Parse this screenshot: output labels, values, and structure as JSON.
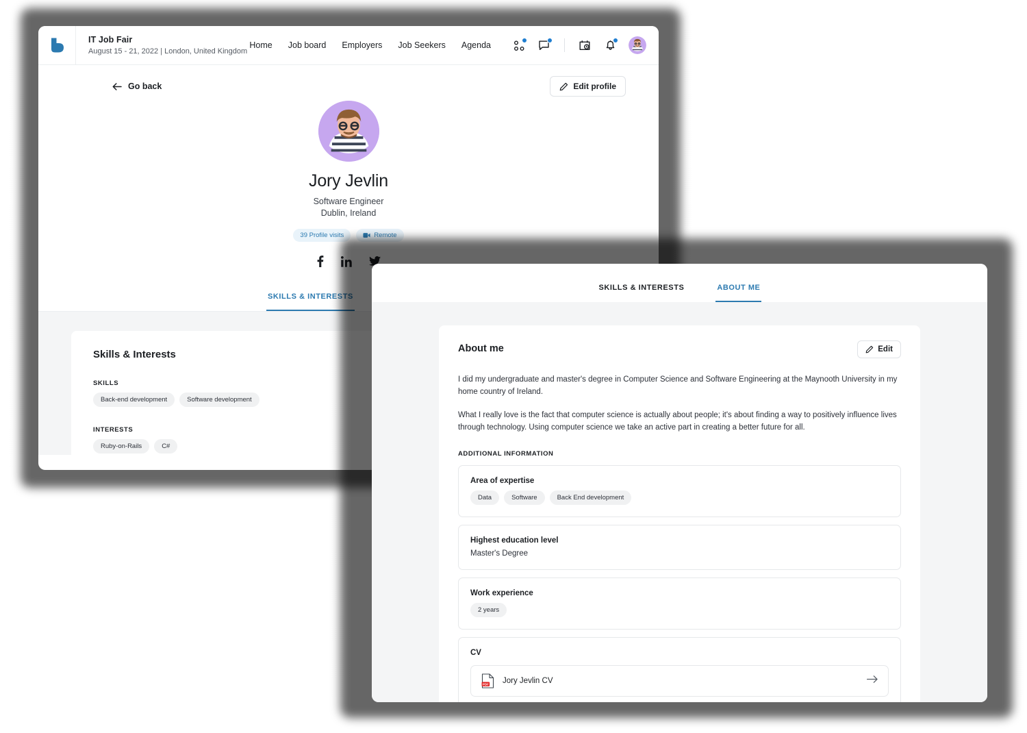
{
  "app": {
    "brand_icon": "leaf-logo-icon",
    "event_title": "IT Job Fair",
    "event_meta": "August 15 - 21, 2022 | London, United Kingdom"
  },
  "nav": {
    "links": [
      {
        "label": "Home"
      },
      {
        "label": "Job board"
      },
      {
        "label": "Employers"
      },
      {
        "label": "Job Seekers"
      },
      {
        "label": "Agenda"
      }
    ],
    "icons": [
      {
        "name": "networking-dots-icon",
        "badge": true
      },
      {
        "name": "chat-bubble-icon",
        "badge": true
      },
      {
        "name": "schedule-calendar-icon",
        "badge": false
      },
      {
        "name": "notification-bell-icon",
        "badge": true
      }
    ],
    "avatar": "user-avatar"
  },
  "actions": {
    "go_back_label": "Go back",
    "edit_profile_label": "Edit profile",
    "back_arrow_icon": "arrow-left-icon",
    "pencil_icon": "pencil-icon"
  },
  "profile": {
    "name": "Jory Jevlin",
    "role": "Software Engineer",
    "location": "Dublin, Ireland",
    "badges": [
      {
        "label": "39 Profile visits",
        "icon": null
      },
      {
        "label": "Remote",
        "icon": "video-camera-icon"
      }
    ],
    "socials": [
      {
        "name": "facebook-icon"
      },
      {
        "name": "linkedin-icon"
      },
      {
        "name": "twitter-icon"
      }
    ],
    "accent_color": "#2c7ab0",
    "badge_bg": "#e9f3fa",
    "avatar_bg": "#c6a7ef"
  },
  "tabs": [
    {
      "label": "SKILLS & INTERESTS",
      "active_rear": true,
      "active_front": false
    },
    {
      "label": "ABOUT ME",
      "active_rear": false,
      "active_front": true
    }
  ],
  "skills_panel": {
    "title": "Skills & Interests",
    "skills_label": "SKILLS",
    "skills": [
      "Back-end development",
      "Software development"
    ],
    "interests_label": "INTERESTS",
    "interests": [
      "Ruby-on-Rails",
      "C#"
    ]
  },
  "about_panel": {
    "title": "About me",
    "edit_label": "Edit",
    "paragraphs": [
      "I did my undergraduate and master's degree in Computer Science and Software Engineering at the Maynooth University in my home country of Ireland.",
      "What I really love is the fact that computer science is actually about people; it's about finding a way to positively influence lives through technology. Using computer science we take an active part in creating a better future for all."
    ],
    "additional_label": "ADDITIONAL INFORMATION",
    "expertise": {
      "title": "Area of expertise",
      "chips": [
        "Data",
        "Software",
        "Back End development"
      ]
    },
    "education": {
      "title": "Highest education level",
      "value": "Master's Degree"
    },
    "work": {
      "title": "Work experience",
      "chips": [
        "2 years"
      ]
    },
    "cv": {
      "title": "CV",
      "file_name": "Jory Jevlin CV",
      "file_icon": "pdf-file-icon",
      "arrow_icon": "arrow-right-icon"
    }
  }
}
